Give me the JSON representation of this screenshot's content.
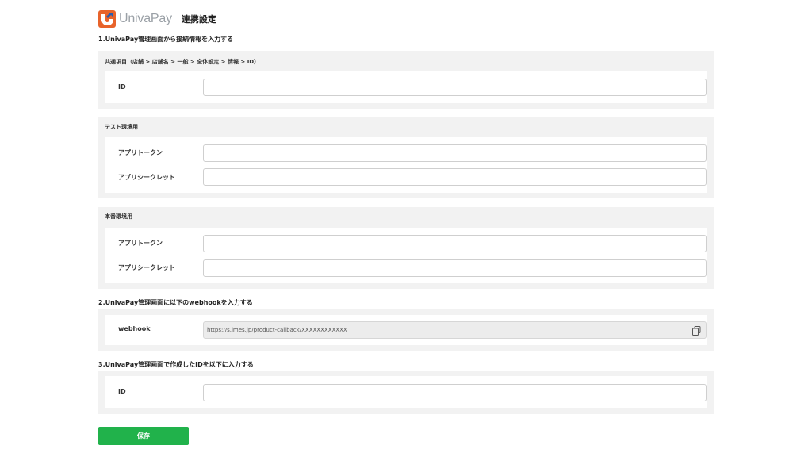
{
  "header": {
    "logo_text": "UnivaPay",
    "title": "連携設定"
  },
  "step1": {
    "title": "1.UnivaPay管理画面から接続情報を入力する",
    "common": {
      "label": "共通項目（店舗 > 店舗名 > 一般 > 全体設定 > 情報 > ID）",
      "id_label": "ID",
      "id_value": ""
    },
    "test": {
      "label": "テスト環境用",
      "token_label": "アプリトークン",
      "token_value": "",
      "secret_label": "アプリシークレット",
      "secret_value": ""
    },
    "production": {
      "label": "本番環境用",
      "token_label": "アプリトークン",
      "token_value": "",
      "secret_label": "アプリシークレット",
      "secret_value": ""
    }
  },
  "step2": {
    "title": "2.UnivaPay管理画面に以下のwebhookを入力する",
    "webhook_label": "webhook",
    "webhook_value": "https://s.lmes.jp/product-callback/XXXXXXXXXXXX"
  },
  "step3": {
    "title": "3.UnivaPay管理画面で作成したIDを以下に入力する",
    "id_label": "ID",
    "id_value": ""
  },
  "save_label": "保存",
  "colors": {
    "accent_green": "#21b24b",
    "panel_bg": "#f2f2f2",
    "logo_orange": "#e8632b",
    "logo_blue": "#2a5db0"
  }
}
